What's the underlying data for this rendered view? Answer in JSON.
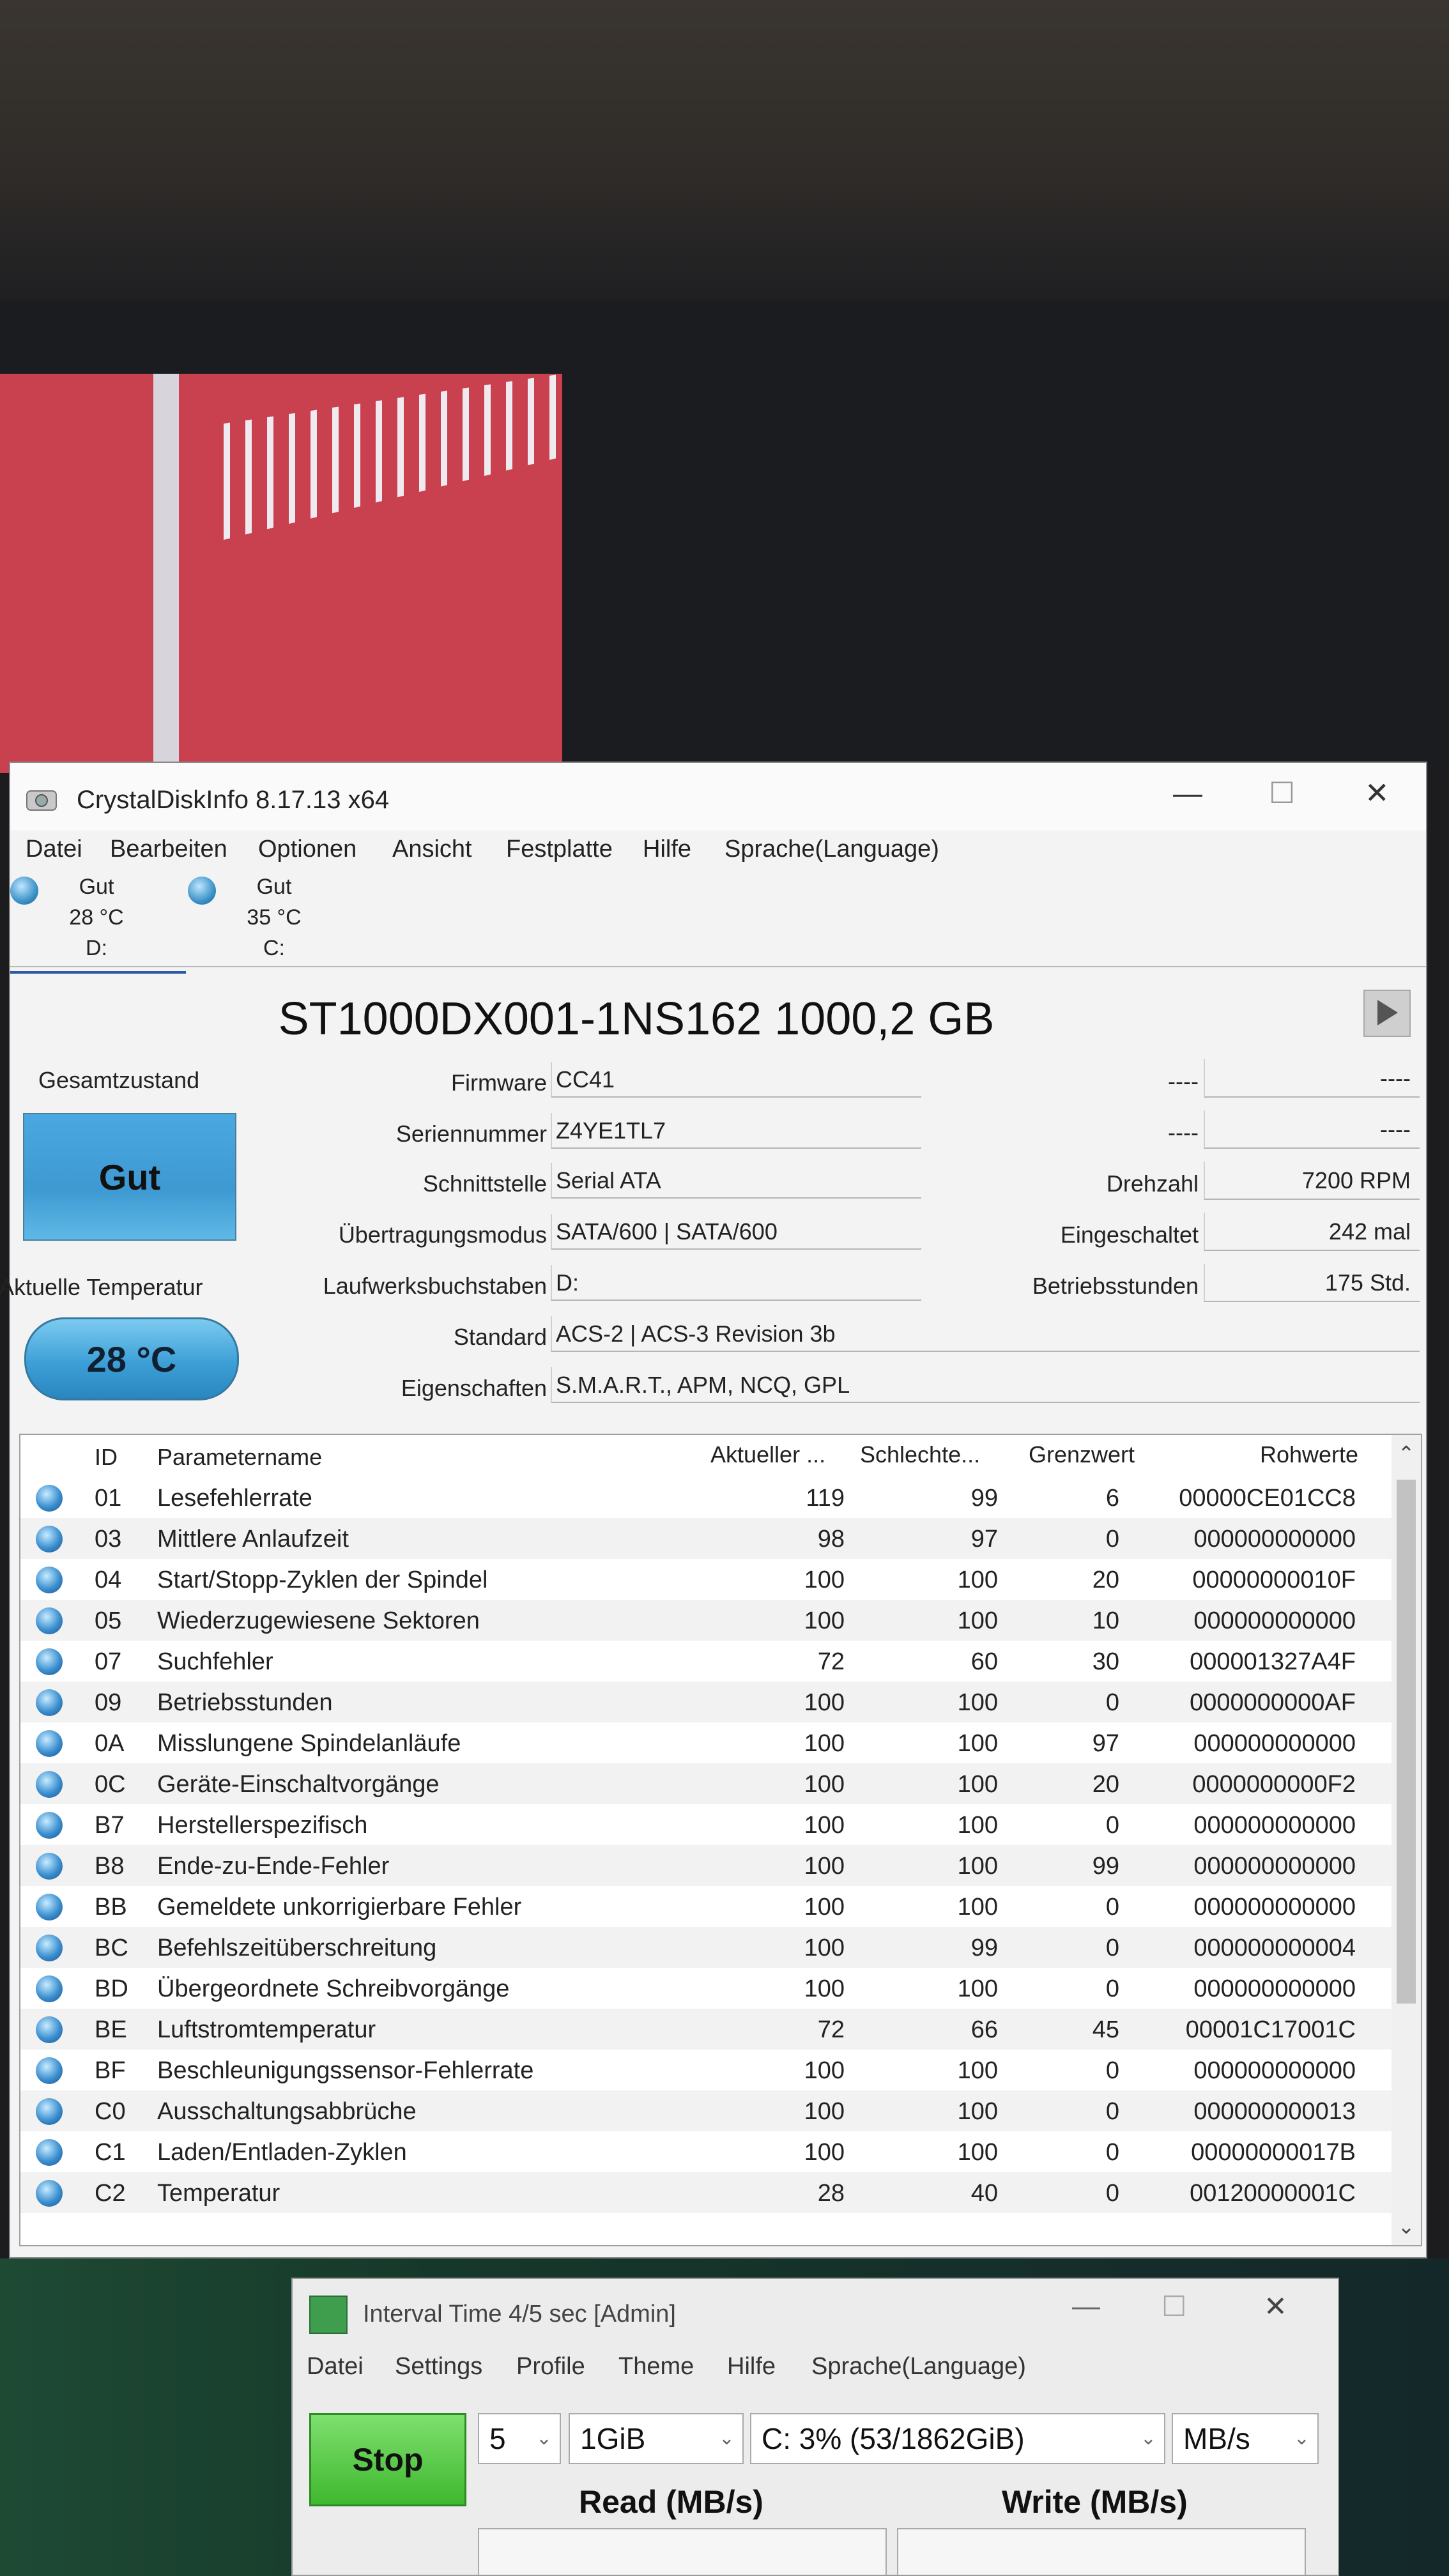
{
  "window": {
    "title": "CrystalDiskInfo 8.17.13 x64",
    "controls": {
      "minimize": "—",
      "maximize": "☐",
      "close": "✕"
    }
  },
  "menu": [
    "Datei",
    "Bearbeiten",
    "Optionen",
    "Ansicht",
    "Festplatte",
    "Hilfe",
    "Sprache(Language)"
  ],
  "drives": [
    {
      "status": "Gut",
      "temp": "28 °C",
      "letter": "D:"
    },
    {
      "status": "Gut",
      "temp": "35 °C",
      "letter": "C:"
    }
  ],
  "disk": {
    "model": "ST1000DX001-1NS162 1000,2 GB",
    "overall_label": "Gesamtzustand",
    "overall_value": "Gut",
    "temp_label": "Aktuelle Temperatur",
    "temp_value": "28 °C",
    "fields": {
      "firmware_label": "Firmware",
      "firmware": "CC41",
      "serial_label": "Seriennummer",
      "serial": "Z4YE1TL7",
      "interface_label": "Schnittstelle",
      "interface": "Serial ATA",
      "transfer_label": "Übertragungsmodus",
      "transfer": "SATA/600 | SATA/600",
      "letters_label": "Laufwerksbuchstaben",
      "letters": "D:",
      "standard_label": "Standard",
      "standard": "ACS-2 | ACS-3 Revision 3b",
      "features_label": "Eigenschaften",
      "features": "S.M.A.R.T., APM, NCQ, GPL"
    },
    "right": {
      "dash1_label": "----",
      "dash1": "----",
      "dash2_label": "----",
      "dash2": "----",
      "rpm_label": "Drehzahl",
      "rpm": "7200 RPM",
      "power_on_count_label": "Eingeschaltet",
      "power_on_count": "242 mal",
      "hours_label": "Betriebsstunden",
      "hours": "175 Std."
    }
  },
  "smart": {
    "headers": {
      "id": "ID",
      "name": "Parametername",
      "current": "Aktueller ...",
      "worst": "Schlechte...",
      "threshold": "Grenzwert",
      "raw": "Rohwerte"
    },
    "rows": [
      {
        "id": "01",
        "name": "Lesefehlerrate",
        "current": "119",
        "worst": "99",
        "threshold": "6",
        "raw": "00000CE01CC8"
      },
      {
        "id": "03",
        "name": "Mittlere Anlaufzeit",
        "current": "98",
        "worst": "97",
        "threshold": "0",
        "raw": "000000000000"
      },
      {
        "id": "04",
        "name": "Start/Stopp-Zyklen der Spindel",
        "current": "100",
        "worst": "100",
        "threshold": "20",
        "raw": "00000000010F"
      },
      {
        "id": "05",
        "name": "Wiederzugewiesene Sektoren",
        "current": "100",
        "worst": "100",
        "threshold": "10",
        "raw": "000000000000"
      },
      {
        "id": "07",
        "name": "Suchfehler",
        "current": "72",
        "worst": "60",
        "threshold": "30",
        "raw": "000001327A4F"
      },
      {
        "id": "09",
        "name": "Betriebsstunden",
        "current": "100",
        "worst": "100",
        "threshold": "0",
        "raw": "0000000000AF"
      },
      {
        "id": "0A",
        "name": "Misslungene Spindelanläufe",
        "current": "100",
        "worst": "100",
        "threshold": "97",
        "raw": "000000000000"
      },
      {
        "id": "0C",
        "name": "Geräte-Einschaltvorgänge",
        "current": "100",
        "worst": "100",
        "threshold": "20",
        "raw": "0000000000F2"
      },
      {
        "id": "B7",
        "name": "Herstellerspezifisch",
        "current": "100",
        "worst": "100",
        "threshold": "0",
        "raw": "000000000000"
      },
      {
        "id": "B8",
        "name": "Ende-zu-Ende-Fehler",
        "current": "100",
        "worst": "100",
        "threshold": "99",
        "raw": "000000000000"
      },
      {
        "id": "BB",
        "name": "Gemeldete unkorrigierbare Fehler",
        "current": "100",
        "worst": "100",
        "threshold": "0",
        "raw": "000000000000"
      },
      {
        "id": "BC",
        "name": "Befehlszeitüberschreitung",
        "current": "100",
        "worst": "99",
        "threshold": "0",
        "raw": "000000000004"
      },
      {
        "id": "BD",
        "name": "Übergeordnete Schreibvorgänge",
        "current": "100",
        "worst": "100",
        "threshold": "0",
        "raw": "000000000000"
      },
      {
        "id": "BE",
        "name": "Luftstromtemperatur",
        "current": "72",
        "worst": "66",
        "threshold": "45",
        "raw": "00001C17001C"
      },
      {
        "id": "BF",
        "name": "Beschleunigungssensor-Fehlerrate",
        "current": "100",
        "worst": "100",
        "threshold": "0",
        "raw": "000000000000"
      },
      {
        "id": "C0",
        "name": "Ausschaltungsabbrüche",
        "current": "100",
        "worst": "100",
        "threshold": "0",
        "raw": "000000000013"
      },
      {
        "id": "C1",
        "name": "Laden/Entladen-Zyklen",
        "current": "100",
        "worst": "100",
        "threshold": "0",
        "raw": "00000000017B"
      },
      {
        "id": "C2",
        "name": "Temperatur",
        "current": "28",
        "worst": "40",
        "threshold": "0",
        "raw": "00120000001C"
      }
    ]
  },
  "colors": {
    "status_good": "#3e99d2",
    "accent": "#2d5aa3"
  },
  "cdm": {
    "title": "Interval Time 4/5 sec [Admin]",
    "menu": [
      "Datei",
      "Settings",
      "Profile",
      "Theme",
      "Hilfe",
      "Sprache(Language)"
    ],
    "stop": "Stop",
    "count": "5",
    "size": "1GiB",
    "drive": "C: 3% (53/1862GiB)",
    "unit": "MB/s",
    "read_header": "Read (MB/s)",
    "write_header": "Write (MB/s)"
  }
}
